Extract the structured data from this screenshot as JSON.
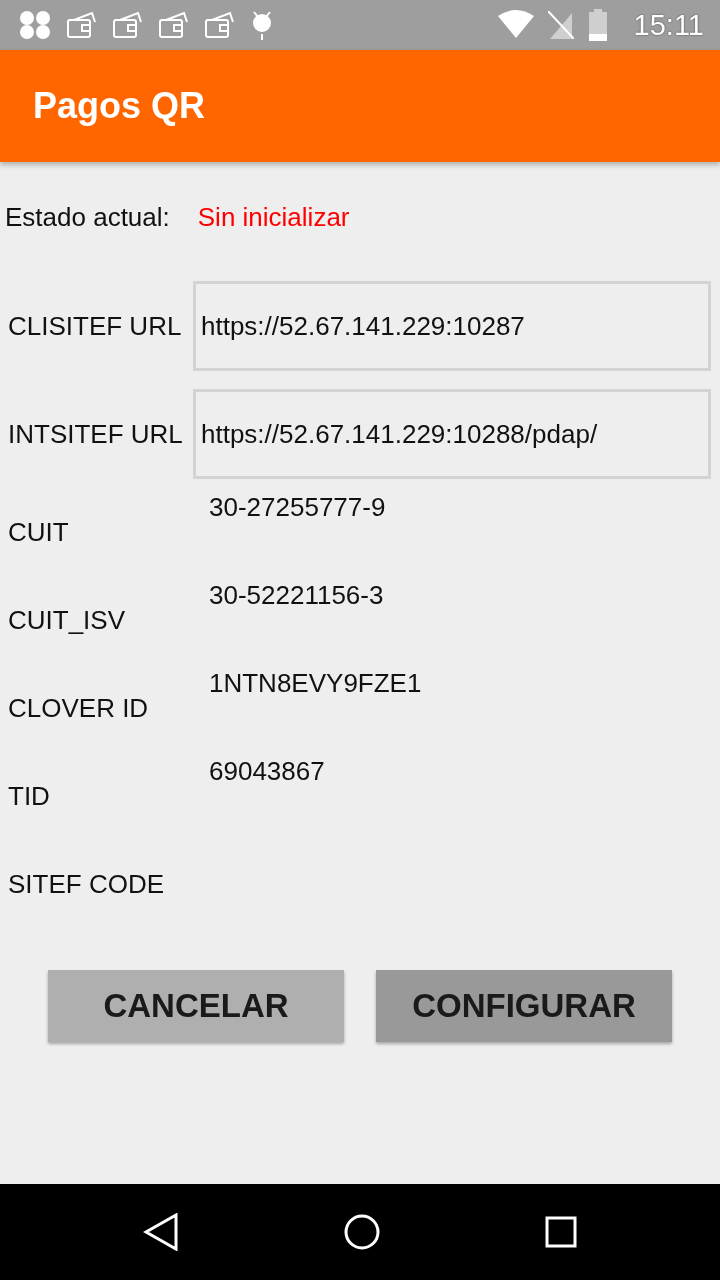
{
  "status_bar": {
    "time": "15:11"
  },
  "app_bar": {
    "title": "Pagos QR"
  },
  "status": {
    "label": "Estado actual:",
    "value": "Sin inicializar",
    "color": "#ff0000"
  },
  "fields": [
    {
      "kind": "input",
      "label": "CLISITEF URL",
      "value": "https://52.67.141.229:10287"
    },
    {
      "kind": "input",
      "label": "INTSITEF URL",
      "value": "https://52.67.141.229:10288/pdap/"
    },
    {
      "kind": "text",
      "label": "CUIT",
      "value": "30-27255777-9"
    },
    {
      "kind": "text",
      "label": "CUIT_ISV",
      "value": "30-52221156-3"
    },
    {
      "kind": "text",
      "label": "CLOVER ID",
      "value": "1NTN8EVY9FZE1"
    },
    {
      "kind": "text",
      "label": "TID",
      "value": "69043867"
    },
    {
      "kind": "text",
      "label": "SITEF CODE"
    }
  ],
  "buttons": [
    {
      "label": "CANCELAR",
      "color": "#afafaf"
    },
    {
      "label": "CONFIGURAR",
      "color": "#999999"
    }
  ]
}
